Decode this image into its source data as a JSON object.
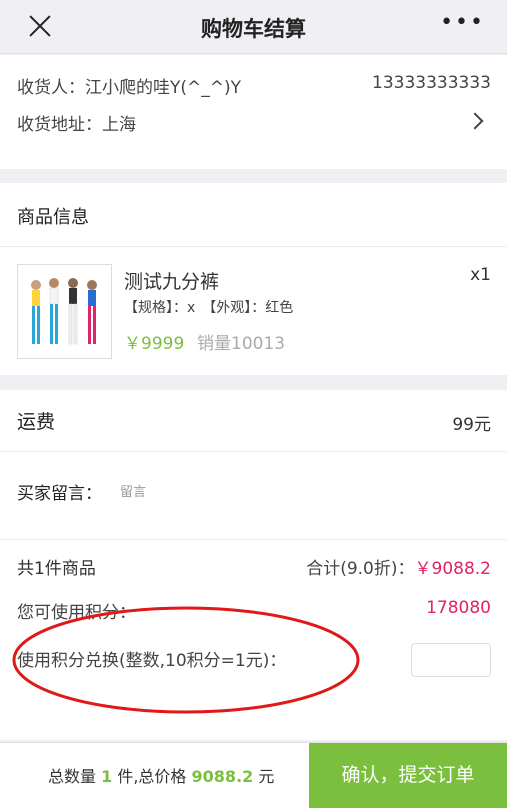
{
  "header": {
    "title": "购物车结算"
  },
  "address": {
    "receiver": "收货人：江小爬的哇Y(^_^)Y",
    "phone": "13333333333",
    "place": "收货地址：上海"
  },
  "goods": {
    "section_title": "商品信息",
    "item": {
      "name": "测试九分裤",
      "qty": "x1",
      "spec": "【规格】：x　【外观】：红色",
      "price": "￥9999",
      "sales": "销量10013"
    }
  },
  "fees": {
    "shipping_label": "运费",
    "shipping_value": "99元",
    "message_label": "买家留言：",
    "message_placeholder": "留言",
    "count_label": "共1件商品",
    "total_label": "合计(9.0折)：",
    "total_value": "￥9088.2",
    "points_label": "您可使用积分：",
    "points_value": "178080",
    "exchange_label": "使用积分兑换(整数,10积分=1元)："
  },
  "footer": {
    "qty_prefix": "总数量",
    "qty_value": "1",
    "qty_mid": "件,总价格",
    "price_value": "9088.2",
    "price_suffix": "元",
    "submit_label": "确认，提交订单"
  },
  "colors": {
    "accent_green": "#7abf3d",
    "price_red": "#e0245e",
    "annotation_red": "#e01818"
  }
}
